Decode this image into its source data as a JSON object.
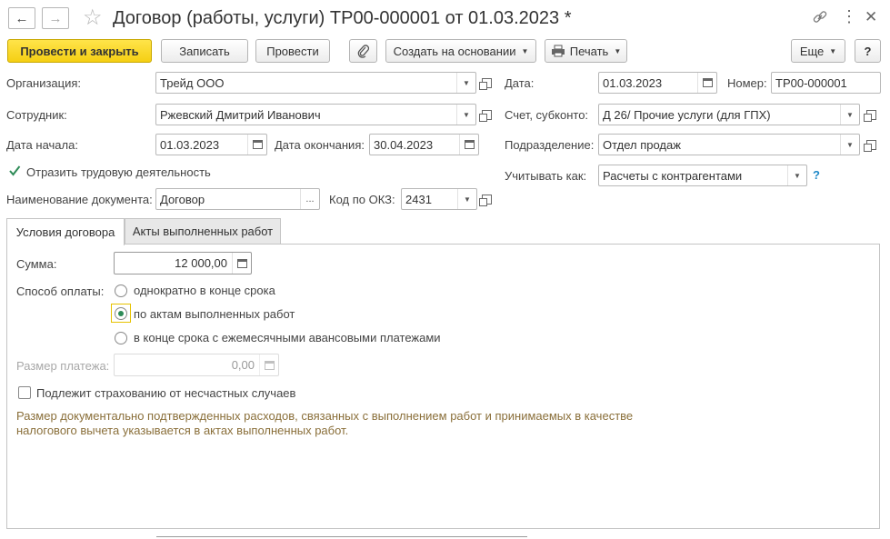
{
  "window": {
    "title": "Договор (работы, услуги) ТР00-000001 от 01.03.2023 *",
    "back_icon": "←",
    "forward_icon": "→",
    "star_icon": "☆",
    "link_icon": "🔗",
    "menu_icon": "⋮",
    "close_icon": "✕"
  },
  "toolbar": {
    "post_close": "Провести и закрыть",
    "write": "Записать",
    "post": "Провести",
    "attach_icon": "📎",
    "create_based": "Создать на основании",
    "print_icon": "🖶",
    "print": "Печать",
    "more": "Еще",
    "help": "?"
  },
  "form": {
    "organization_label": "Организация:",
    "organization_value": "Трейд ООО",
    "employee_label": "Сотрудник:",
    "employee_value": "Ржевский Дмитрий Иванович",
    "start_label": "Дата начала:",
    "start_value": "01.03.2023",
    "end_label": "Дата окончания:",
    "end_value": "30.04.2023",
    "reflect_label": "Отразить трудовую деятельность",
    "reflect_checked": true,
    "docname_label": "Наименование документа:",
    "docname_value": "Договор",
    "okz_label": "Код по ОКЗ:",
    "okz_value": "2431",
    "date_label": "Дата:",
    "date_value": "01.03.2023",
    "number_label": "Номер:",
    "number_value": "ТР00-000001",
    "account_label": "Счет, субконто:",
    "account_value": "Д 26/ Прочие услуги (для ГПХ)",
    "dept_label": "Подразделение:",
    "dept_value": "Отдел продаж",
    "account_as_label": "Учитывать как:",
    "account_as_value": "Расчеты с контрагентами",
    "question": "?"
  },
  "tabs": [
    {
      "label": "Условия договора",
      "active": true
    },
    {
      "label": "Акты выполненных работ",
      "active": false
    }
  ],
  "contract": {
    "sum_label": "Сумма:",
    "sum_value": "12 000,00",
    "payment_label": "Способ оплаты:",
    "payment_options": [
      {
        "label": "однократно в конце срока",
        "selected": false
      },
      {
        "label": "по актам выполненных работ",
        "selected": true
      },
      {
        "label": "в конце срока с ежемесячными авансовыми платежами",
        "selected": false
      }
    ],
    "payment_size_label": "Размер платежа:",
    "payment_size_value": "0,00",
    "insurance_label": "Подлежит страхованию от несчастных случаев",
    "insurance_checked": false,
    "note": "Размер документально подтвержденных расходов, связанных с выполнением работ и принимаемых в качестве налогового вычета указывается в актах выполненных работ."
  },
  "colors": {
    "primary_button": "#f5cf13",
    "accent_green": "#2e8b57",
    "note_text": "#8a6f3a",
    "help_blue": "#1e88c8"
  }
}
